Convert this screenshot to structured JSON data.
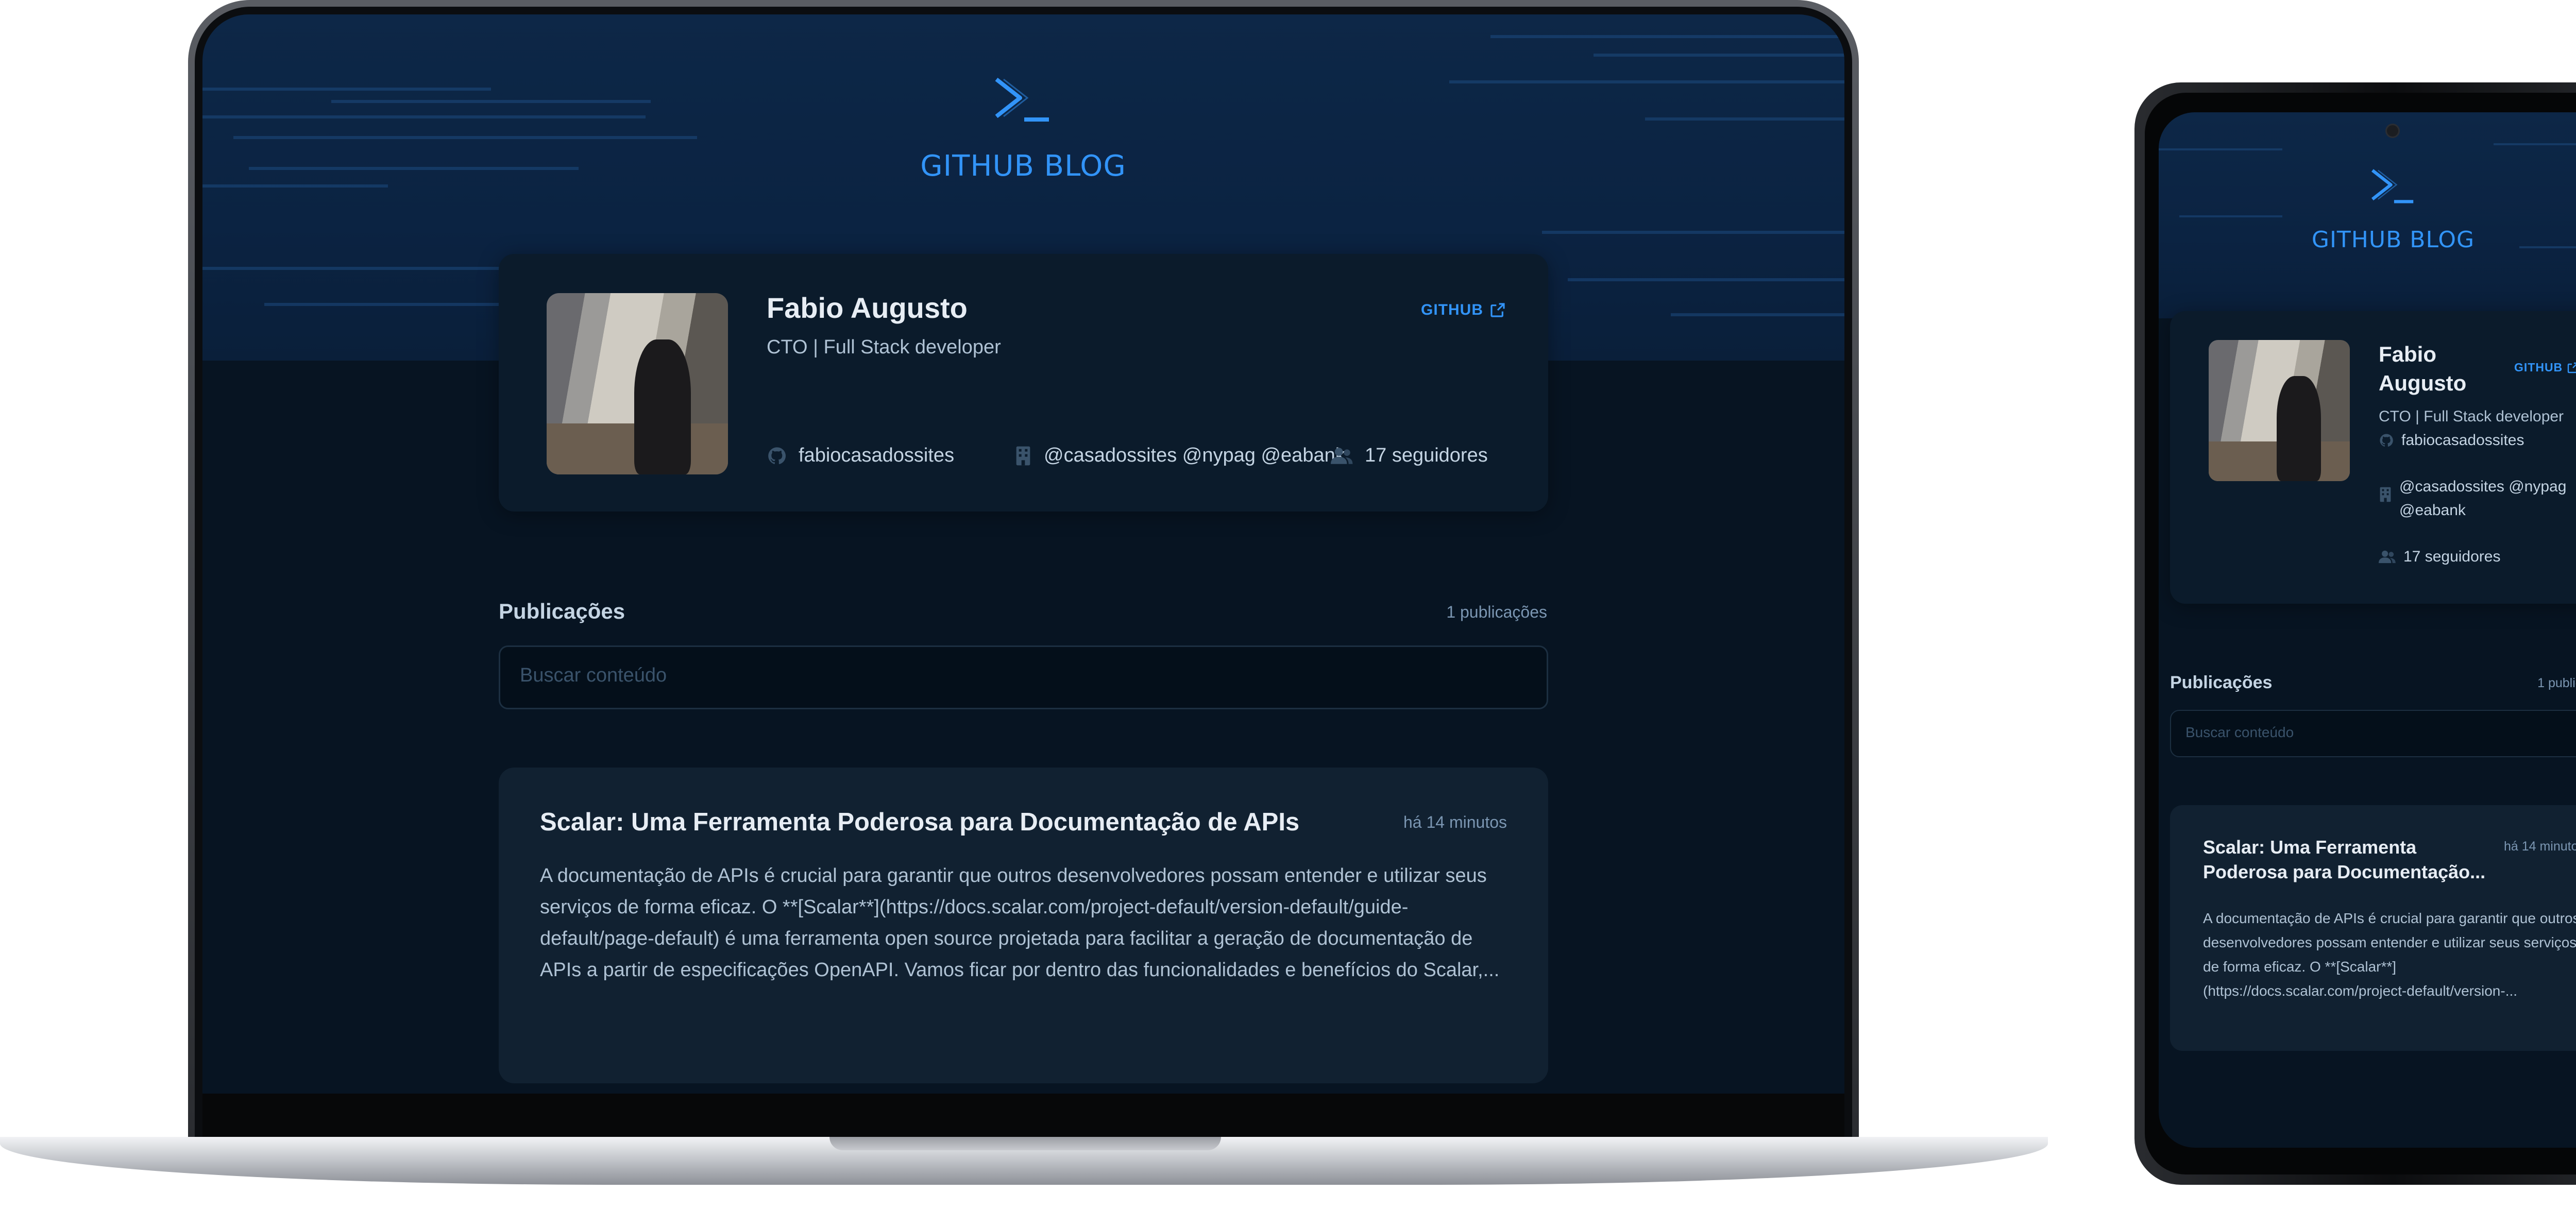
{
  "app": {
    "title": "GITHUB BLOG"
  },
  "profile": {
    "name": "Fabio Augusto",
    "bio": "CTO | Full Stack developer",
    "github_link": "GITHUB",
    "username": "fabiocasadossites",
    "company": "@casadossites @nypag @eabank",
    "company_mobile_line1": "@casadossites @nypag",
    "company_mobile_line2": "@eabank",
    "followers": "17 seguidores"
  },
  "publications": {
    "title": "Publicações",
    "count": "1 publicações",
    "search_placeholder": "Buscar conteúdo"
  },
  "post": {
    "title": "Scalar: Uma Ferramenta Poderosa para Documentação de APIs",
    "title_mobile_line1": "Scalar: Uma Ferramenta",
    "title_mobile_line2": "Poderosa para Documentação...",
    "time": "há 14 minutos",
    "excerpt": "A documentação de APIs é crucial para garantir que outros desenvolvedores possam entender e utilizar seus serviços de forma eficaz. O **[Scalar**](https://docs.scalar.com/project-default/version-default/guide-default/page-default) é uma ferramenta open source projetada para facilitar a geração de documentação de APIs a partir de especificações OpenAPI. Vamos ficar por dentro das funcionalidades e benefícios do Scalar,...",
    "excerpt_mobile": "A documentação de APIs é crucial para garantir que outros desenvolvedores possam entender e utilizar seus serviços de forma eficaz. O **[Scalar**](https://docs.scalar.com/project-default/version-..."
  },
  "icons": {
    "logo": "terminal-prompt-icon",
    "external": "external-link-icon",
    "github": "github-icon",
    "company": "building-icon",
    "followers": "users-icon"
  },
  "colors": {
    "accent": "#3294f8",
    "background": "#071422",
    "card": "#0b1b2b",
    "post_card": "#112131"
  }
}
